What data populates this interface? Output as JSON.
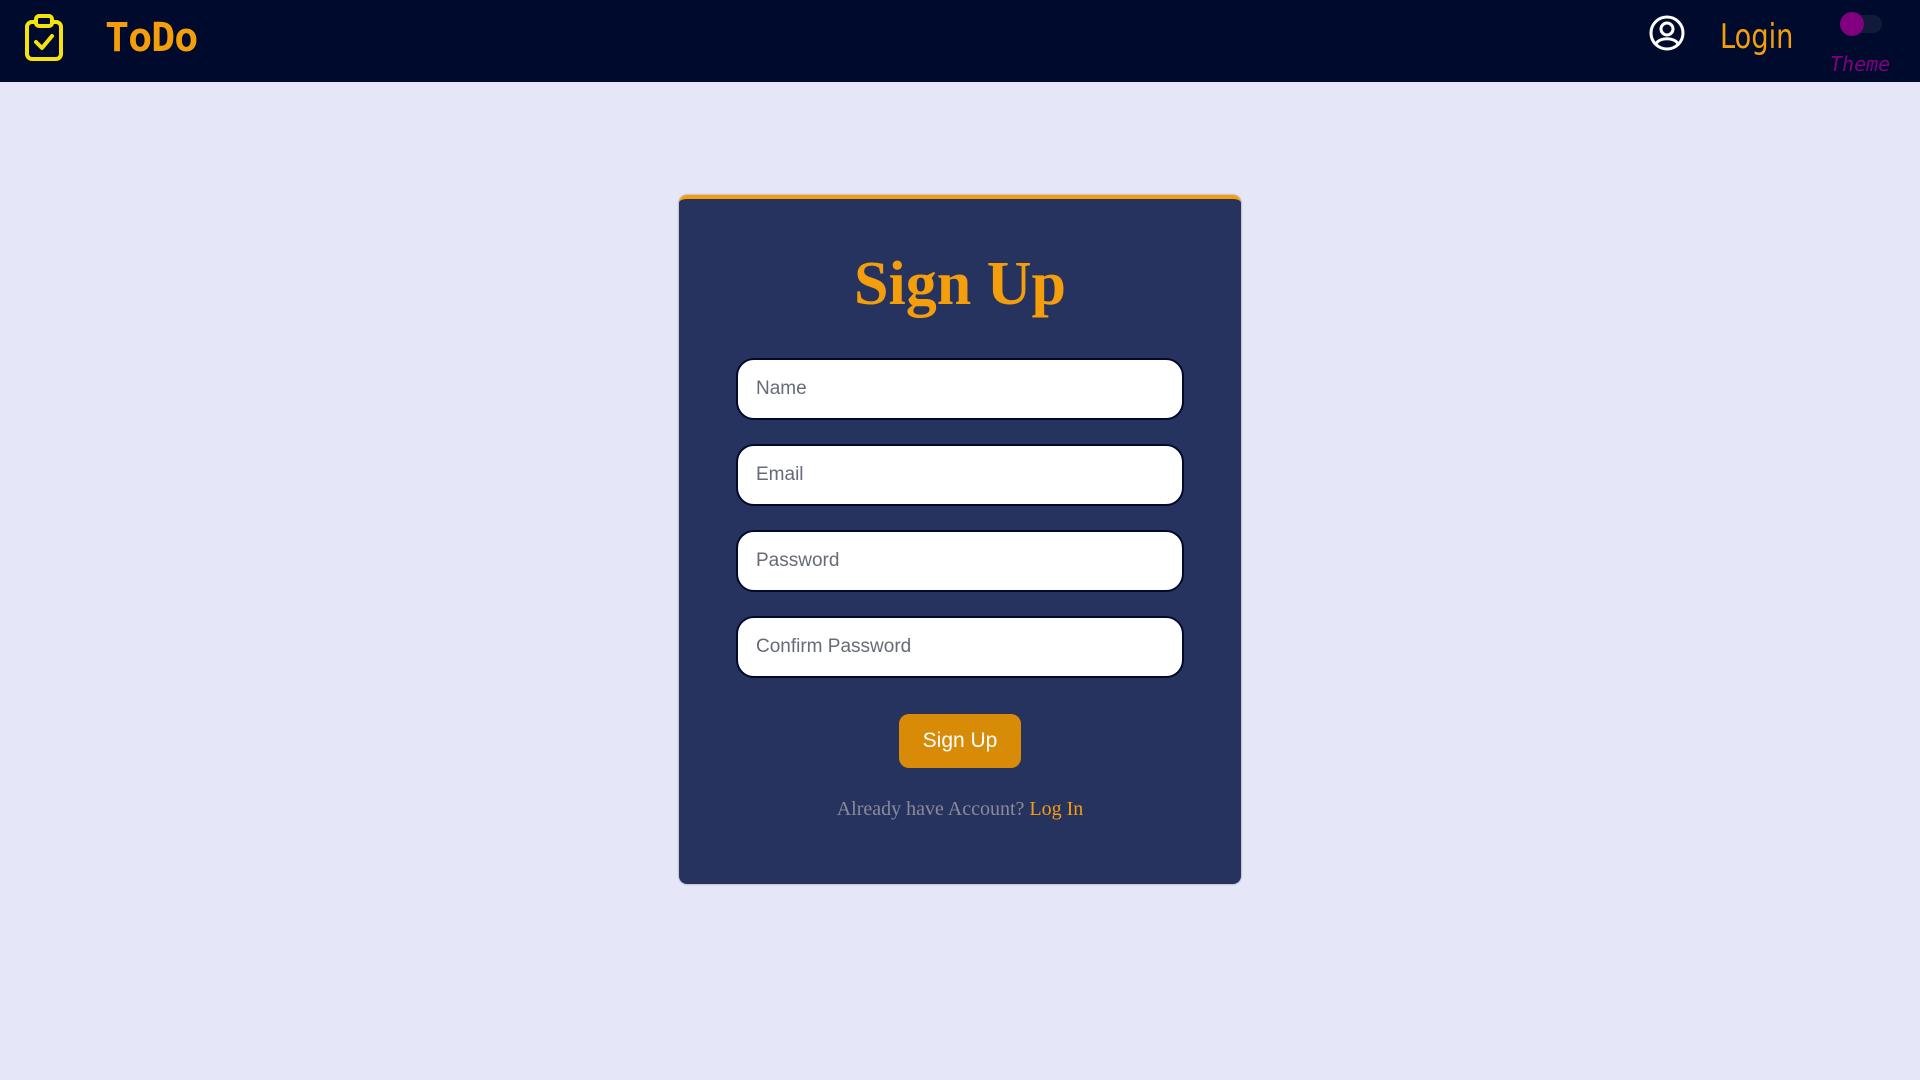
{
  "app": {
    "title": "ToDo",
    "brand_icon": "clipboard-check-icon"
  },
  "nav": {
    "user_icon": "user-circle-icon",
    "login_label": "Login",
    "theme_label": "Theme",
    "theme_toggle_on": false
  },
  "signup": {
    "title": "Sign Up",
    "fields": {
      "name": {
        "placeholder": "Name",
        "value": ""
      },
      "email": {
        "placeholder": "Email",
        "value": ""
      },
      "password": {
        "placeholder": "Password",
        "value": ""
      },
      "confirm_password": {
        "placeholder": "Confirm Password",
        "value": ""
      }
    },
    "submit_label": "Sign Up",
    "prompt_text": "Already have Account?",
    "prompt_link": "Log In"
  },
  "colors": {
    "navbar_bg": "#000a2d",
    "page_bg": "#e6e6f9",
    "card_bg": "#27335f",
    "accent": "#f59e0b",
    "button_bg": "#d88b07",
    "brand_icon": "#f5e30b",
    "theme": "#800080"
  }
}
